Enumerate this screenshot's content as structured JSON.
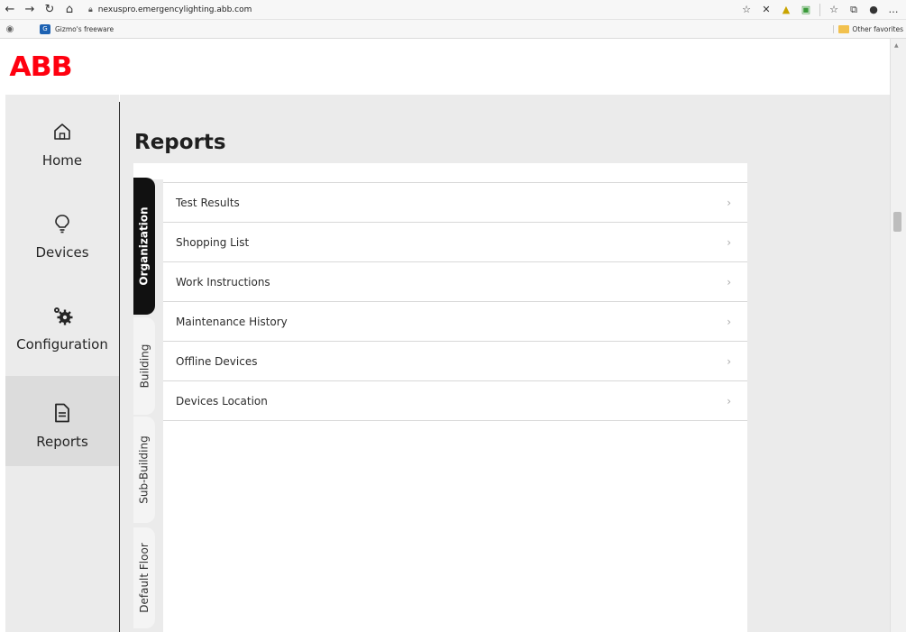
{
  "browser": {
    "url": "nexuspro.emergencylighting.abb.com",
    "favorites": [
      {
        "label": "Gizmo's freeware"
      }
    ],
    "other_favorites": "Other favorites"
  },
  "brand": {
    "logo_text": "ABB",
    "accent": "#ff000f"
  },
  "sidebar": {
    "items": [
      {
        "label": "Home",
        "icon": "home-icon"
      },
      {
        "label": "Devices",
        "icon": "lightbulb-icon"
      },
      {
        "label": "Configuration",
        "icon": "gears-icon"
      },
      {
        "label": "Reports",
        "icon": "document-icon",
        "active": true
      }
    ]
  },
  "main": {
    "title": "Reports",
    "tabs": [
      {
        "label": "Organization",
        "active": true
      },
      {
        "label": "Building"
      },
      {
        "label": "Sub-Building"
      },
      {
        "label": "Default Floor"
      }
    ],
    "reports": [
      {
        "label": "Test Results"
      },
      {
        "label": "Shopping List"
      },
      {
        "label": "Work Instructions"
      },
      {
        "label": "Maintenance History"
      },
      {
        "label": "Offline Devices"
      },
      {
        "label": "Devices Location"
      }
    ]
  }
}
